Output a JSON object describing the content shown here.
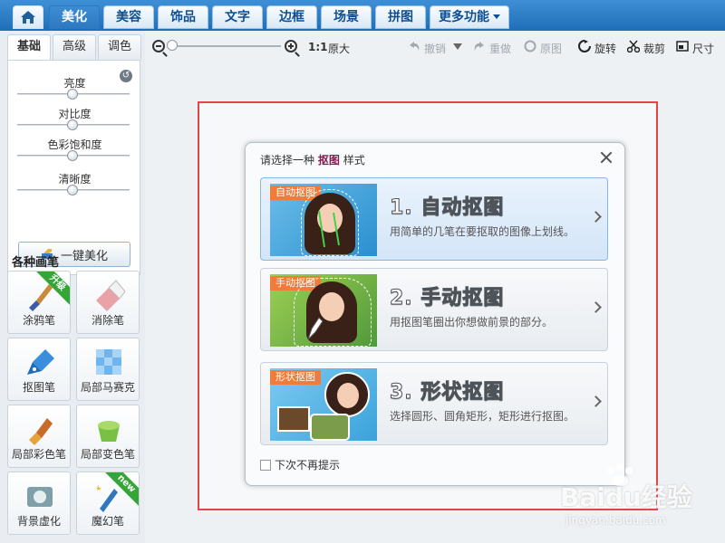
{
  "nav": {
    "tabs": [
      {
        "label": "美化",
        "active": true
      },
      {
        "label": "美容"
      },
      {
        "label": "饰品"
      },
      {
        "label": "文字"
      },
      {
        "label": "边框"
      },
      {
        "label": "场景"
      },
      {
        "label": "拼图"
      },
      {
        "label": "更多功能"
      }
    ]
  },
  "panel": {
    "subtabs": [
      "基础",
      "高级",
      "调色"
    ],
    "sliders": [
      {
        "label": "亮度",
        "value": 0.5
      },
      {
        "label": "对比度",
        "value": 0.5
      },
      {
        "label": "色彩饱和度",
        "value": 0.5
      },
      {
        "label": "清晰度",
        "value": 0.5
      }
    ],
    "onekey_label": "一键美化",
    "brush_title": "各种画笔",
    "tools": [
      {
        "label": "涂鸦笔",
        "badge": "升级"
      },
      {
        "label": "消除笔"
      },
      {
        "label": "抠图笔"
      },
      {
        "label": "局部马赛克"
      },
      {
        "label": "局部彩色笔"
      },
      {
        "label": "局部变色笔"
      },
      {
        "label": "背景虚化"
      },
      {
        "label": "魔幻笔",
        "badge": "new"
      }
    ]
  },
  "toolbar": {
    "zoom_ratio": "1:1",
    "original_size": "原大",
    "undo": "撤销",
    "redo": "重做",
    "original": "原图",
    "rotate": "旋转",
    "crop": "裁剪",
    "size": "尺寸"
  },
  "dialog": {
    "title_prefix": "请选择一种",
    "title_highlight": "抠图",
    "title_suffix": "样式",
    "options": [
      {
        "tag": "自动抠图",
        "heading": "1. 自动抠图",
        "desc": "用简单的几笔在要抠取的图像上划线。"
      },
      {
        "tag": "手动抠图",
        "heading": "2. 手动抠图",
        "desc": "用抠图笔圈出你想做前景的部分。"
      },
      {
        "tag": "形状抠图",
        "heading": "3. 形状抠图",
        "desc": "选择圆形、圆角矩形，矩形进行抠图。"
      }
    ],
    "checkbox_label": "下次不再提示"
  },
  "watermark": {
    "brand": "Baidu经验",
    "site": "jingyan.baidu.com"
  },
  "colors": {
    "nav_active": "#2e7ac2",
    "highlight": "#8a1750",
    "frame": "#e0454a"
  }
}
